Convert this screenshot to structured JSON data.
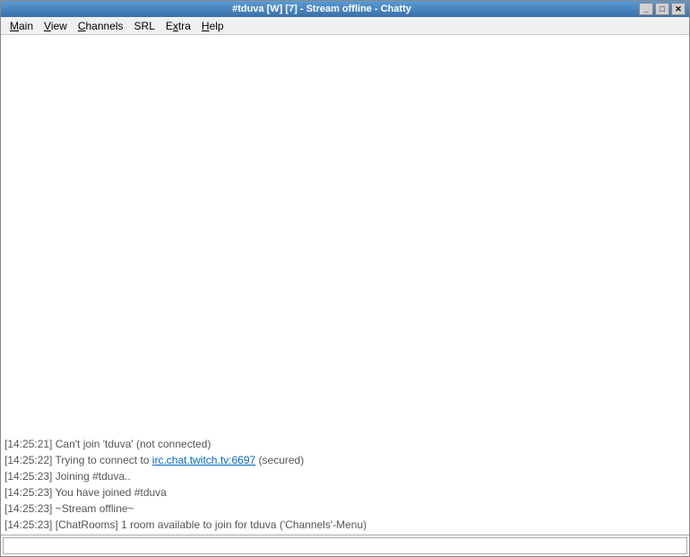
{
  "window": {
    "title": "#tduva [W] [7] - Stream offline - Chatty",
    "controls": {
      "minimize": "_",
      "maximize": "□",
      "close": "✕"
    }
  },
  "menubar": {
    "items": [
      {
        "id": "main",
        "label": "Main",
        "underline_index": 0
      },
      {
        "id": "view",
        "label": "View",
        "underline_index": 0
      },
      {
        "id": "channels",
        "label": "Channels",
        "underline_index": 0
      },
      {
        "id": "srl",
        "label": "SRL",
        "underline_index": 0
      },
      {
        "id": "extra",
        "label": "Extra",
        "underline_index": 0
      },
      {
        "id": "help",
        "label": "Help",
        "underline_index": 0
      }
    ]
  },
  "chat": {
    "messages": [
      {
        "id": "msg1",
        "timestamp": "[14:25:21]",
        "text": " Can't join 'tduva' (not connected)",
        "type": "system"
      },
      {
        "id": "msg2",
        "timestamp": "[14:25:22]",
        "text_before": " Trying to connect to ",
        "link": "irc.chat.twitch.tv:6697",
        "text_after": " (secured)",
        "type": "link"
      },
      {
        "id": "msg3",
        "timestamp": "[14:25:23]",
        "text": " Joining #tduva..",
        "type": "system"
      },
      {
        "id": "msg4",
        "timestamp": "[14:25:23]",
        "text": " You have joined #tduva",
        "type": "system"
      },
      {
        "id": "msg5",
        "timestamp": "[14:25:23]",
        "text": " ~Stream offline~",
        "type": "system"
      },
      {
        "id": "msg6",
        "timestamp": "[14:25:23]",
        "text": " [ChatRooms] 1 room available to join for tduva ('Channels'-Menu)",
        "type": "system"
      }
    ],
    "input_placeholder": ""
  }
}
